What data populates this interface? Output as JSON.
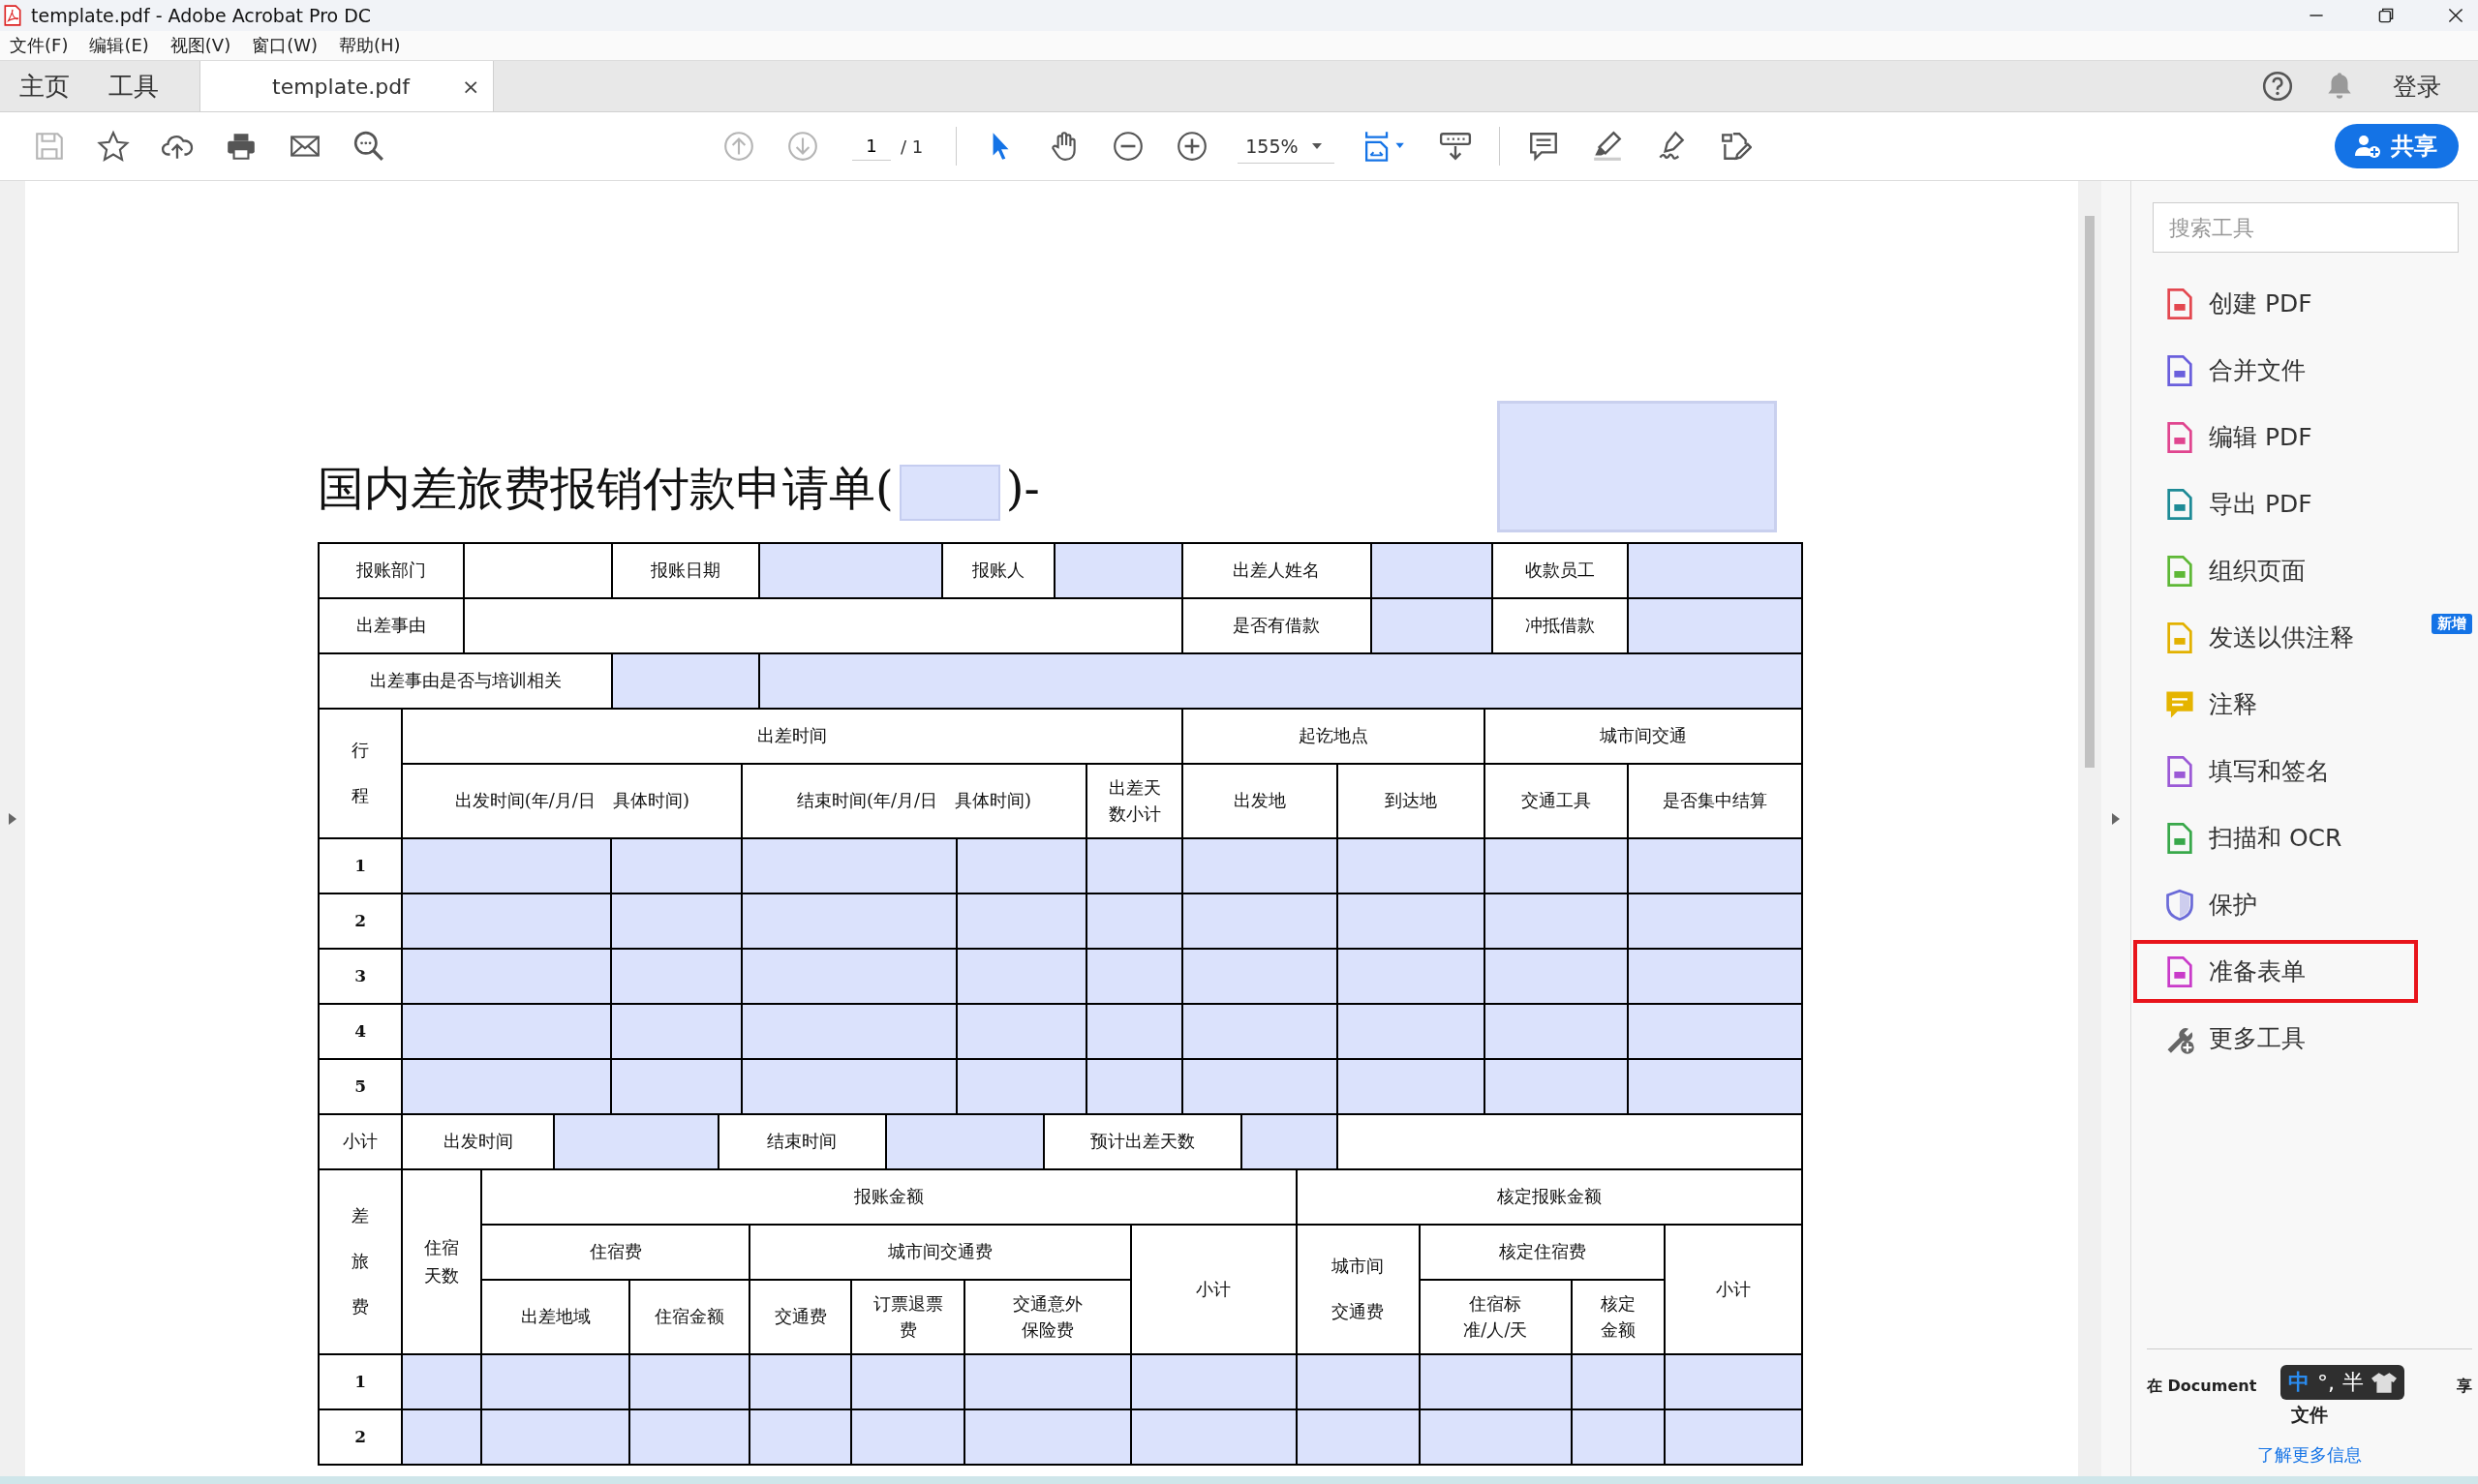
{
  "window": {
    "title": "template.pdf - Adobe Acrobat Pro DC"
  },
  "menu": [
    "文件(F)",
    "编辑(E)",
    "视图(V)",
    "窗口(W)",
    "帮助(H)"
  ],
  "tabs": [
    {
      "label": "主页",
      "selected": false
    },
    {
      "label": "工具",
      "selected": false
    },
    {
      "label": "template.pdf",
      "selected": true,
      "close": "×"
    }
  ],
  "account": {
    "sign_in": "登录"
  },
  "toolbar": {
    "save_disabled": true,
    "prev_disabled": true,
    "next_disabled": true,
    "page": "1",
    "page_total": "/ 1",
    "zoom": "155%",
    "share": "共享",
    "modes": [
      {
        "selected": true
      },
      {
        "selected": false
      }
    ]
  },
  "form": {
    "title": "国内差旅费报销付款申请单(",
    "title_end": ")-",
    "sections": [
      {
        "kind": "info",
        "rows": [
          [
            {
              "kind": "label",
              "text": "报账部门"
            },
            {
              "kind": "blank"
            },
            {
              "kind": "label",
              "text": "报账日期"
            },
            {
              "kind": "field"
            },
            {
              "kind": "label",
              "text": "报账人"
            },
            {
              "kind": "field"
            },
            {
              "kind": "label",
              "text": "出差人姓名"
            },
            {
              "kind": "field"
            },
            {
              "kind": "label",
              "text": "收款员工"
            },
            {
              "kind": "field"
            }
          ],
          [
            {
              "kind": "label",
              "text": "出差事由"
            },
            {
              "kind": "blank",
              "colspan": 5
            },
            {
              "kind": "label",
              "text": "是否有借款"
            },
            {
              "kind": "field"
            },
            {
              "kind": "label",
              "text": "冲抵借款"
            },
            {
              "kind": "field"
            }
          ],
          [
            {
              "kind": "label",
              "text": "出差事由是否与培训相关",
              "colspan": 2
            },
            {
              "kind": "field"
            },
            {
              "kind": "field",
              "colspan": 7
            }
          ]
        ]
      },
      {
        "kind": "trip",
        "rows": [
          [
            {
              "kind": "label",
              "text": "行程",
              "rowspan": 2
            },
            {
              "kind": "label",
              "text": "出差时间",
              "colspan": 5
            },
            {
              "kind": "label",
              "text": "起讫地点",
              "colspan": 2
            },
            {
              "kind": "label",
              "text": "城市间交通",
              "colspan": 2
            }
          ],
          [
            {
              "kind": "label",
              "text": "出发时间(年/月/日　具体时间)",
              "colspan": 2
            },
            {
              "kind": "label",
              "text": "结束时间(年/月/日　具体时间)",
              "colspan": 2
            },
            {
              "kind": "label",
              "text": "出差天数小计"
            },
            {
              "kind": "label",
              "text": "出发地"
            },
            {
              "kind": "label",
              "text": "到达地"
            },
            {
              "kind": "label",
              "text": "交通工具"
            },
            {
              "kind": "label",
              "text": "是否集中结算"
            }
          ],
          [
            {
              "kind": "num",
              "text": "1"
            },
            {
              "kind": "field"
            },
            {
              "kind": "field"
            },
            {
              "kind": "field"
            },
            {
              "kind": "field"
            },
            {
              "kind": "field"
            },
            {
              "kind": "field"
            },
            {
              "kind": "field"
            },
            {
              "kind": "field"
            },
            {
              "kind": "field"
            }
          ],
          [
            {
              "kind": "num",
              "text": "2"
            },
            {
              "kind": "field"
            },
            {
              "kind": "field"
            },
            {
              "kind": "field"
            },
            {
              "kind": "field"
            },
            {
              "kind": "field"
            },
            {
              "kind": "field"
            },
            {
              "kind": "field"
            },
            {
              "kind": "field"
            },
            {
              "kind": "field"
            }
          ],
          [
            {
              "kind": "num",
              "text": "3"
            },
            {
              "kind": "field"
            },
            {
              "kind": "field"
            },
            {
              "kind": "field"
            },
            {
              "kind": "field"
            },
            {
              "kind": "field"
            },
            {
              "kind": "field"
            },
            {
              "kind": "field"
            },
            {
              "kind": "field"
            },
            {
              "kind": "field"
            }
          ],
          [
            {
              "kind": "num",
              "text": "4"
            },
            {
              "kind": "field"
            },
            {
              "kind": "field"
            },
            {
              "kind": "field"
            },
            {
              "kind": "field"
            },
            {
              "kind": "field"
            },
            {
              "kind": "field"
            },
            {
              "kind": "field"
            },
            {
              "kind": "field"
            },
            {
              "kind": "field"
            }
          ],
          [
            {
              "kind": "num",
              "text": "5"
            },
            {
              "kind": "field"
            },
            {
              "kind": "field"
            },
            {
              "kind": "field"
            },
            {
              "kind": "field"
            },
            {
              "kind": "field"
            },
            {
              "kind": "field"
            },
            {
              "kind": "field"
            },
            {
              "kind": "field"
            },
            {
              "kind": "field"
            }
          ]
        ]
      },
      {
        "kind": "subtotal",
        "rows": [
          [
            {
              "kind": "label",
              "text": "小计"
            },
            {
              "kind": "label",
              "text": "出发时间"
            },
            {
              "kind": "field"
            },
            {
              "kind": "label",
              "text": "结束时间"
            },
            {
              "kind": "field"
            },
            {
              "kind": "label",
              "text": "预计出差天数"
            },
            {
              "kind": "field"
            },
            {
              "kind": "blank"
            }
          ]
        ]
      },
      {
        "kind": "expense",
        "rows": [
          [
            {
              "kind": "label",
              "text": "差旅费",
              "rowspan": 3
            },
            {
              "kind": "label",
              "text": "住宿天数",
              "rowspan": 3
            },
            {
              "kind": "label",
              "text": "报账金额",
              "colspan": 6
            },
            {
              "kind": "label",
              "text": "核定报账金额",
              "colspan": 4
            }
          ],
          [
            {
              "kind": "label",
              "text": "住宿费",
              "colspan": 2
            },
            {
              "kind": "label",
              "text": "城市间交通费",
              "colspan": 3
            },
            {
              "kind": "label",
              "text": "小计",
              "rowspan": 2
            },
            {
              "kind": "label",
              "text": "城市间交通费",
              "rowspan": 2
            },
            {
              "kind": "label",
              "text": "核定住宿费",
              "colspan": 2
            },
            {
              "kind": "label",
              "text": "小计",
              "rowspan": 2
            }
          ],
          [
            {
              "kind": "label",
              "text": "出差地域"
            },
            {
              "kind": "label",
              "text": "住宿金额"
            },
            {
              "kind": "label",
              "text": "交通费"
            },
            {
              "kind": "label",
              "text": "订票退票费"
            },
            {
              "kind": "label",
              "text": "交通意外保险费"
            },
            {
              "kind": "label",
              "text": "住宿标准/人/天"
            },
            {
              "kind": "label",
              "text": "核定金额"
            }
          ],
          [
            {
              "kind": "num",
              "text": "1"
            },
            {
              "kind": "field"
            },
            {
              "kind": "field"
            },
            {
              "kind": "field"
            },
            {
              "kind": "field"
            },
            {
              "kind": "field"
            },
            {
              "kind": "field"
            },
            {
              "kind": "field"
            },
            {
              "kind": "field"
            },
            {
              "kind": "field"
            },
            {
              "kind": "field"
            },
            {
              "kind": "field"
            }
          ],
          [
            {
              "kind": "num",
              "text": "2"
            },
            {
              "kind": "field"
            },
            {
              "kind": "field"
            },
            {
              "kind": "field"
            },
            {
              "kind": "field"
            },
            {
              "kind": "field"
            },
            {
              "kind": "field"
            },
            {
              "kind": "field"
            },
            {
              "kind": "field"
            },
            {
              "kind": "field"
            },
            {
              "kind": "field"
            },
            {
              "kind": "field"
            }
          ]
        ]
      }
    ]
  },
  "tool_panel": {
    "search": {
      "placeholder": "搜索工具"
    },
    "tools": [
      {
        "label": "创建 PDF",
        "color": "#e34850",
        "highlighted": false
      },
      {
        "label": "合并文件",
        "color": "#6a5fdc",
        "highlighted": false
      },
      {
        "label": "编辑 PDF",
        "color": "#e0458f",
        "highlighted": false
      },
      {
        "label": "导出 PDF",
        "color": "#1d8a96",
        "highlighted": false
      },
      {
        "label": "组织页面",
        "color": "#5eb836",
        "highlighted": false
      },
      {
        "label": "发送以供注释",
        "color": "#e2b100",
        "highlighted": false,
        "badge": "新增"
      },
      {
        "label": "注释",
        "color": "#e5b400",
        "highlighted": false
      },
      {
        "label": "填写和签名",
        "color": "#9b5ad6",
        "highlighted": false
      },
      {
        "label": "扫描和 OCR",
        "color": "#38a84a",
        "highlighted": false
      },
      {
        "label": "保护",
        "color": "#6b6bd8",
        "highlighted": false
      },
      {
        "label": "准备表单",
        "color": "#c93bc9",
        "highlighted": true
      },
      {
        "label": "更多工具",
        "color": "#666666",
        "highlighted": false
      }
    ],
    "footer": {
      "line_start": "在 Document",
      "line_end": "享",
      "line_2": "文件",
      "link": "了解更多信息"
    }
  },
  "ime_bar": {
    "mode": "中",
    "punct": "°,",
    "width": "半"
  }
}
